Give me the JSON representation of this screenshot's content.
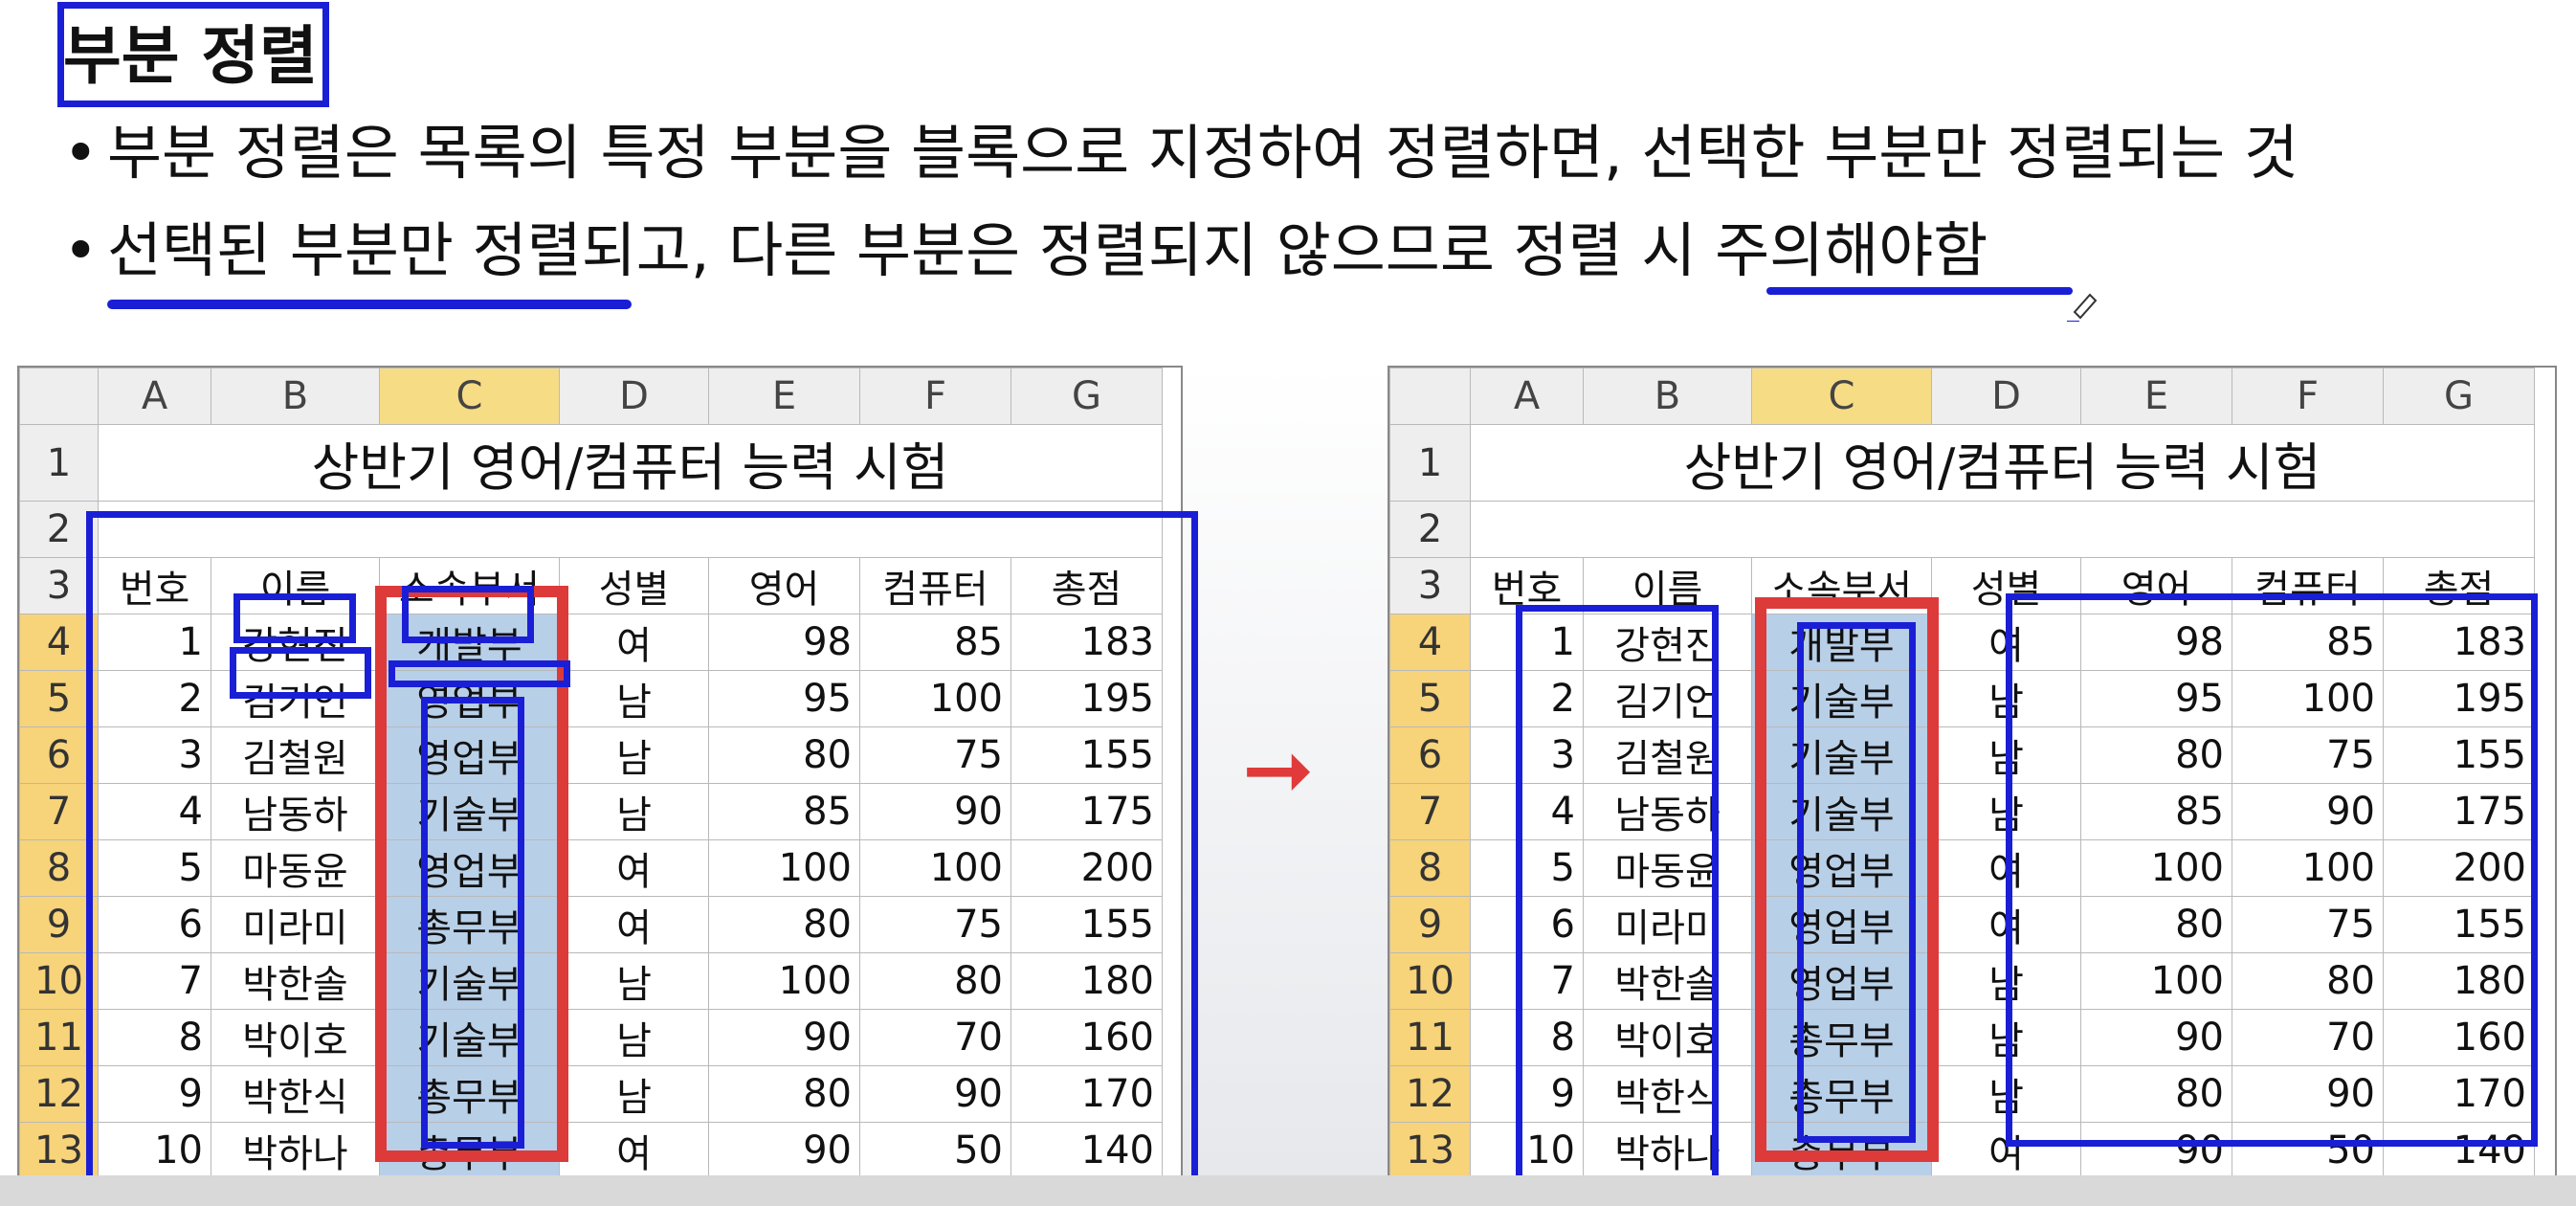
{
  "heading": "부분 정렬",
  "bullets": [
    "부분 정렬은 목록의 특정 부분을 블록으로 지정하여 정렬하면, 선택한 부분만 정렬되는 것",
    "선택된 부분만 정렬되고, 다른 부분은 정렬되지 않으므로 정렬 시 주의해야함"
  ],
  "bullet_char": "•",
  "arrow": "➞",
  "columns": [
    "A",
    "B",
    "C",
    "D",
    "E",
    "F",
    "G"
  ],
  "sheet_title": "상반기 영어/컴퓨터 능력 시험",
  "table_headers": [
    "번호",
    "이름",
    "소속부서",
    "성별",
    "영어",
    "컴퓨터",
    "총점"
  ],
  "before": {
    "rows": [
      [
        "1",
        "강현진",
        "개발부",
        "여",
        "98",
        "85",
        "183"
      ],
      [
        "2",
        "김기언",
        "영업부",
        "남",
        "95",
        "100",
        "195"
      ],
      [
        "3",
        "김철원",
        "영업부",
        "남",
        "80",
        "75",
        "155"
      ],
      [
        "4",
        "남동하",
        "기술부",
        "남",
        "85",
        "90",
        "175"
      ],
      [
        "5",
        "마동윤",
        "영업부",
        "여",
        "100",
        "100",
        "200"
      ],
      [
        "6",
        "미라미",
        "총무부",
        "여",
        "80",
        "75",
        "155"
      ],
      [
        "7",
        "박한솔",
        "기술부",
        "남",
        "100",
        "80",
        "180"
      ],
      [
        "8",
        "박이호",
        "기술부",
        "남",
        "90",
        "70",
        "160"
      ],
      [
        "9",
        "박한식",
        "총무부",
        "남",
        "80",
        "90",
        "170"
      ],
      [
        "10",
        "박하나",
        "총무부",
        "여",
        "90",
        "50",
        "140"
      ]
    ]
  },
  "after": {
    "rows": [
      [
        "1",
        "강현진",
        "개발부",
        "여",
        "98",
        "85",
        "183"
      ],
      [
        "2",
        "김기언",
        "기술부",
        "남",
        "95",
        "100",
        "195"
      ],
      [
        "3",
        "김철원",
        "기술부",
        "남",
        "80",
        "75",
        "155"
      ],
      [
        "4",
        "남동하",
        "기술부",
        "남",
        "85",
        "90",
        "175"
      ],
      [
        "5",
        "마동윤",
        "영업부",
        "여",
        "100",
        "100",
        "200"
      ],
      [
        "6",
        "미라미",
        "영업부",
        "여",
        "80",
        "75",
        "155"
      ],
      [
        "7",
        "박한솔",
        "영업부",
        "남",
        "100",
        "80",
        "180"
      ],
      [
        "8",
        "박이호",
        "총무부",
        "남",
        "90",
        "70",
        "160"
      ],
      [
        "9",
        "박한식",
        "총무부",
        "남",
        "80",
        "90",
        "170"
      ],
      [
        "10",
        "박하나",
        "총무부",
        "여",
        "90",
        "50",
        "140"
      ]
    ]
  },
  "colors": {
    "annotation_blue": "#1a1fd6",
    "annotation_red": "#dd3a3a",
    "selection_fill": "#b8cfe8",
    "selected_header": "#f7dc86"
  }
}
